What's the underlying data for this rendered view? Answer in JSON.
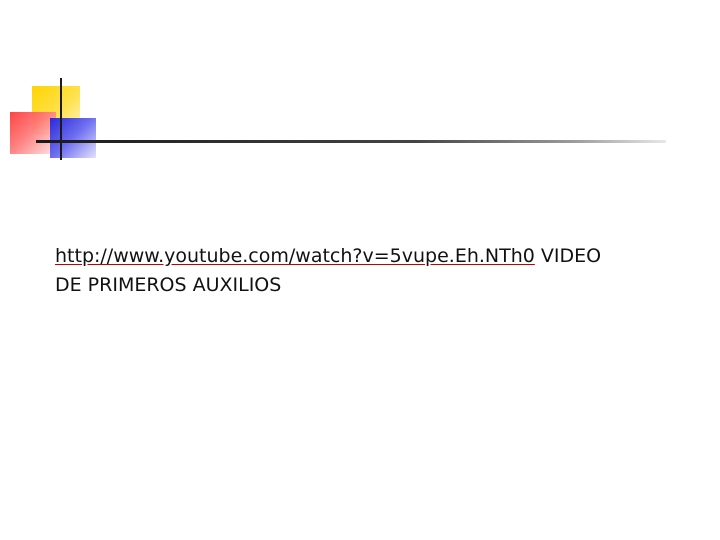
{
  "slide": {
    "link_text": "http://www.youtube.com/watch?v=5vupe.Eh.NTh0",
    "after_link_text": " VIDEO",
    "second_line_text": "DE PRIMEROS AUXILIOS"
  },
  "colors": {
    "accent_yellow": "#ffd400",
    "accent_red": "#ff3a3a",
    "accent_blue": "#2a2ad8",
    "rule_dark": "#1a1a1a",
    "link_underline": "#c00000"
  }
}
